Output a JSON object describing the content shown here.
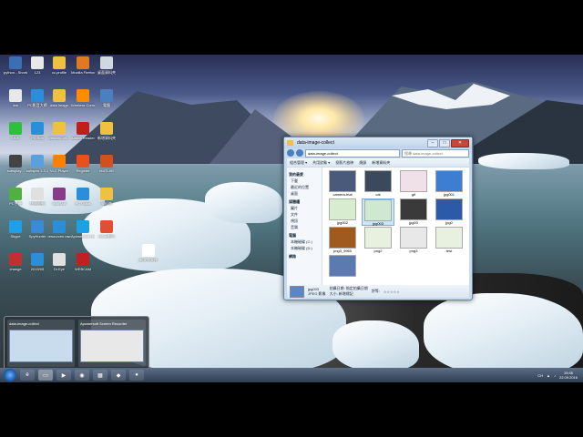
{
  "desktop": {
    "icons": [
      {
        "label": "python - Shortcut",
        "color": "#3a6fb5"
      },
      {
        "label": "123",
        "color": "#e8e8e8"
      },
      {
        "label": "cc-profile",
        "color": "#f0c040"
      },
      {
        "label": "Mozilla Firefox",
        "color": "#e07a20"
      },
      {
        "label": "桌面資料夾",
        "color": "#cfd8e0"
      },
      {
        "label": "line",
        "color": "#e8e8e8"
      },
      {
        "label": "PC影音大師",
        "color": "#2a8fd8"
      },
      {
        "label": "data image",
        "color": "#f0c040"
      },
      {
        "label": "Wireless Connect",
        "color": "#ff8c00"
      },
      {
        "label": "電腦",
        "color": "#4a7fc0"
      },
      {
        "label": "LINE",
        "color": "#2fbf3f"
      },
      {
        "label": "PC Box",
        "color": "#2a8fd8"
      },
      {
        "label": "velocity-gri...",
        "color": "#f0c040"
      },
      {
        "label": "Adobe Reader DC",
        "color": "#c0201a"
      },
      {
        "label": "新增資料夾",
        "color": "#f0c040"
      },
      {
        "label": "subsplay...",
        "color": "#444"
      },
      {
        "label": "subspro 1.3.1",
        "color": "#5aa0e0"
      },
      {
        "label": "VLC Player",
        "color": "#ff8000"
      },
      {
        "label": "Register",
        "color": "#e85020"
      },
      {
        "label": "MATLAB",
        "color": "#d05020"
      },
      {
        "label": "PC手機",
        "color": "#50b040"
      },
      {
        "label": "快速啟動",
        "color": "#e0e0e0"
      },
      {
        "label": "WinRAR",
        "color": "#8a3a8a"
      },
      {
        "label": "PC Quick",
        "color": "#2a8fd8"
      },
      {
        "label": "資料夾",
        "color": "#f0c040"
      },
      {
        "label": "Skype",
        "color": "#1ea0e8"
      },
      {
        "label": "SpyHunter",
        "color": "#3a8ad8"
      },
      {
        "label": "resources raw",
        "color": "#2a8fd8"
      },
      {
        "label": "Apowersoft Recorder",
        "color": "#1ea0e8"
      },
      {
        "label": "HiNet數位",
        "color": "#e05030"
      },
      {
        "label": "change",
        "color": "#c03030"
      },
      {
        "label": "2015/05",
        "color": "#2a8fd8"
      },
      {
        "label": "Dr.Eye",
        "color": "#e0e0e0"
      },
      {
        "label": "WEBCAM",
        "color": "#c02020"
      },
      {
        "label": "新文字文件",
        "color": "#ffffff"
      }
    ]
  },
  "explorer": {
    "title": "data-image-collect",
    "path": "data-image-collect",
    "search_placeholder": "搜尋 data-image-collect",
    "toolbar": [
      "組合管理 ▾",
      "共用對象 ▾",
      "投影片放映",
      "燒錄",
      "新增資料夾"
    ],
    "nav": [
      {
        "label": "我的最愛",
        "group": true
      },
      {
        "label": "下載",
        "group": false
      },
      {
        "label": "最近的位置",
        "group": false
      },
      {
        "label": "桌面",
        "group": false
      },
      {
        "label": "媒體櫃",
        "group": true
      },
      {
        "label": "圖片",
        "group": false
      },
      {
        "label": "文件",
        "group": false
      },
      {
        "label": "視訊",
        "group": false
      },
      {
        "label": "音樂",
        "group": false
      },
      {
        "label": "電腦",
        "group": true
      },
      {
        "label": "本機磁碟 (C:)",
        "group": false
      },
      {
        "label": "本機磁碟 (D:)",
        "group": false
      },
      {
        "label": "網路",
        "group": true
      }
    ],
    "files": [
      {
        "name": "camera-trial",
        "color": "#4a5a7a",
        "selected": false
      },
      {
        "name": "cat",
        "color": "#3a4a5a",
        "selected": false
      },
      {
        "name": "gif",
        "color": "#f0e0e8",
        "selected": false
      },
      {
        "name": "jpg001",
        "color": "#3d7ed0",
        "selected": false
      },
      {
        "name": "jpg002",
        "color": "#d8ecd0",
        "selected": false
      },
      {
        "name": "jpg003",
        "color": "#d0e8d0",
        "selected": true
      },
      {
        "name": "jpg00",
        "color": "#3a3a3a",
        "selected": false
      },
      {
        "name": "jpg0",
        "color": "#2a5aa8",
        "selected": false
      },
      {
        "name": "png3_9960",
        "color": "#a05a20",
        "selected": false
      },
      {
        "name": "png2",
        "color": "#e8f0e0",
        "selected": false
      },
      {
        "name": "png3",
        "color": "#e8e8e8",
        "selected": false
      },
      {
        "name": "test",
        "color": "#e8f0e0",
        "selected": false
      },
      {
        "name": "",
        "color": "#5a7ab0",
        "selected": false
      }
    ],
    "details": {
      "name": "jpg003",
      "type": "JPEG 影像",
      "date_label": "拍攝日期: 指定拍攝日期",
      "rating_label": "評等:",
      "stars": "☆☆☆☆☆",
      "size_label": "大小: 新增標記"
    }
  },
  "previews": [
    {
      "title": "data-image-collect"
    },
    {
      "title": "Apowersoft Screen Recorder"
    }
  ],
  "taskbar": {
    "buttons": [
      {
        "icon": "ie-icon",
        "glyph": "e",
        "active": false
      },
      {
        "icon": "folder-icon",
        "glyph": "▭",
        "active": true
      },
      {
        "icon": "media-icon",
        "glyph": "▶",
        "active": false
      },
      {
        "icon": "chrome-icon",
        "glyph": "◉",
        "active": false
      },
      {
        "icon": "photo-icon",
        "glyph": "▦",
        "active": false
      },
      {
        "icon": "app-icon",
        "glyph": "◆",
        "active": false
      },
      {
        "icon": "recorder-icon",
        "glyph": "●",
        "active": false
      }
    ],
    "lang": "CH",
    "time": "19:46",
    "date": "22.09.2016"
  }
}
